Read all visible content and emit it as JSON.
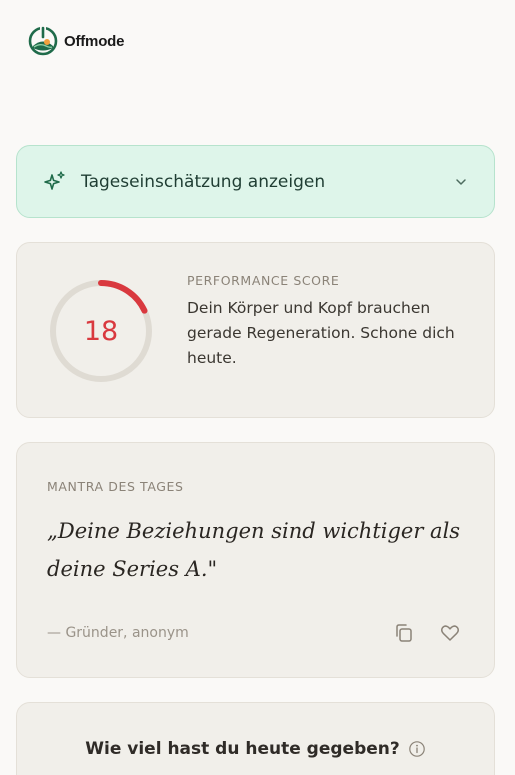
{
  "app": {
    "brand_name": "Offmode",
    "brand_color": "#1f6b4a"
  },
  "insight": {
    "label": "Tageseinschätzung anzeigen",
    "icon": "sparkle-icon",
    "toggle_icon": "chevron-down-icon"
  },
  "performance": {
    "eyebrow": "PERFORMANCE SCORE",
    "score": "18",
    "score_max": 100,
    "score_color": "#d9393f",
    "description": "Dein Körper und Kopf brauchen gerade Regeneration. Schone dich heute."
  },
  "mantra": {
    "eyebrow": "MANTRA DES TAGES",
    "quote": "„Deine Beziehungen sind wichtiger als deine Series A.\"",
    "author": "— Gründer, anonym",
    "copy_icon": "copy-icon",
    "like_icon": "heart-icon"
  },
  "give": {
    "title": "Wie viel hast du heute gegeben?",
    "info_icon": "info-icon"
  }
}
